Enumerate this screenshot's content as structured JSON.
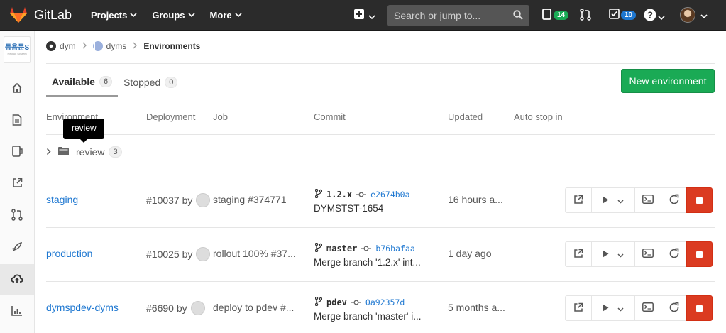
{
  "navbar": {
    "brand": "GitLab",
    "menus": [
      {
        "label": "Projects"
      },
      {
        "label": "Groups"
      },
      {
        "label": "More"
      }
    ],
    "search_placeholder": "Search or jump to...",
    "issues_count": "14",
    "todos_count": "10",
    "icons": [
      "plus-icon",
      "issues-icon",
      "merge-request-icon",
      "todo-icon",
      "help-icon",
      "user-avatar"
    ]
  },
  "sidebar": {
    "project_avatar_text": "등용문S",
    "project_avatar_subtext": "Recruit System",
    "items": [
      "home-icon",
      "repository-icon",
      "issues-icon",
      "external-link-icon",
      "merge-request-icon",
      "ci-cd-icon",
      "operations-icon",
      "analytics-icon"
    ]
  },
  "breadcrumb": {
    "items": [
      "dym",
      "dyms",
      "Environments"
    ]
  },
  "tabs": [
    {
      "label": "Available",
      "count": "6",
      "active": true
    },
    {
      "label": "Stopped",
      "count": "0",
      "active": false
    }
  ],
  "new_environment_label": "New environment",
  "columns": {
    "environment": "Environment",
    "deployment": "Deployment",
    "job": "Job",
    "commit": "Commit",
    "updated": "Updated",
    "auto_stop": "Auto stop in"
  },
  "tooltip": "review",
  "folder": {
    "name": "review",
    "count": "3"
  },
  "environments": [
    {
      "name": "staging",
      "deployment": "#10037 by",
      "job": "staging #374771",
      "ref": "1.2.x",
      "sha": "e2674b0a",
      "message": "DYMSTST-1654",
      "updated": "16 hours a..."
    },
    {
      "name": "production",
      "deployment": "#10025 by",
      "job": "rollout 100% #37...",
      "ref": "master",
      "sha": "b76bafaa",
      "message": "Merge branch '1.2.x' int...",
      "updated": "1 day ago"
    },
    {
      "name": "dymspdev-dyms",
      "deployment": "#6690 by",
      "job": "deploy to pdev #...",
      "ref": "pdev",
      "sha": "0a92357d",
      "message": "Merge branch 'master' i...",
      "updated": "5 months a..."
    }
  ],
  "colors": {
    "navbar": "#2b2b2b",
    "link": "#1f78d1",
    "new_button": "#1aaa55",
    "stop_button": "#db3b21",
    "issues_badge": "#1aaa55",
    "todos_badge": "#1f78d1"
  }
}
